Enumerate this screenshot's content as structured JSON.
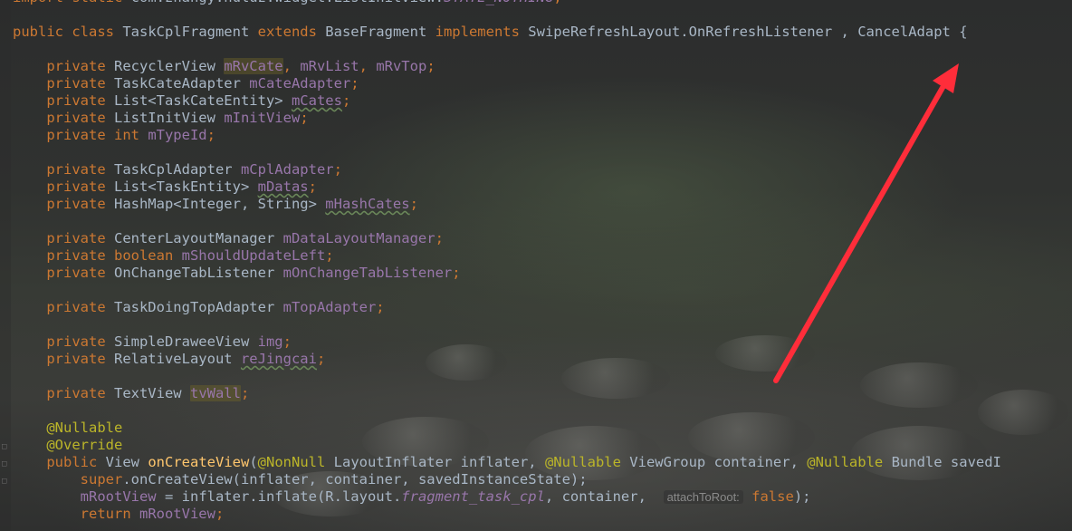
{
  "editor": {
    "lines": [
      [
        [
          "kw",
          "import static "
        ],
        [
          "txt",
          "com.zhangy.huluz.widget.ListInitView."
        ],
        [
          "it",
          "STATE_NOTHING"
        ],
        [
          "kw",
          ";"
        ]
      ],
      [],
      [
        [
          "kw",
          "public class "
        ],
        [
          "txt",
          "TaskCplFragment "
        ],
        [
          "kw",
          "extends "
        ],
        [
          "txt",
          "BaseFragment "
        ],
        [
          "kw",
          "implements "
        ],
        [
          "txt",
          "SwipeRefreshLayout.OnRefreshListener , CancelAdapt {"
        ]
      ],
      [],
      [
        [
          "txt",
          "    "
        ],
        [
          "kw",
          "private "
        ],
        [
          "txt",
          "RecyclerView "
        ],
        [
          "fldhl",
          "mRvCate"
        ],
        [
          "kw",
          ", "
        ],
        [
          "fld",
          "mRvList"
        ],
        [
          "kw",
          ", "
        ],
        [
          "fld",
          "mRvTop"
        ],
        [
          "kw",
          ";"
        ]
      ],
      [
        [
          "txt",
          "    "
        ],
        [
          "kw",
          "private "
        ],
        [
          "txt",
          "TaskCateAdapter "
        ],
        [
          "fld",
          "mCateAdapter"
        ],
        [
          "kw",
          ";"
        ]
      ],
      [
        [
          "txt",
          "    "
        ],
        [
          "kw",
          "private "
        ],
        [
          "txt",
          "List<TaskCateEntity> "
        ],
        [
          "fldsq",
          "mCates"
        ],
        [
          "kw",
          ";"
        ]
      ],
      [
        [
          "txt",
          "    "
        ],
        [
          "kw",
          "private "
        ],
        [
          "txt",
          "ListInitView "
        ],
        [
          "fld",
          "mInitView"
        ],
        [
          "kw",
          ";"
        ]
      ],
      [
        [
          "txt",
          "    "
        ],
        [
          "kw",
          "private int "
        ],
        [
          "fld",
          "mTypeId"
        ],
        [
          "kw",
          ";"
        ]
      ],
      [],
      [
        [
          "txt",
          "    "
        ],
        [
          "kw",
          "private "
        ],
        [
          "txt",
          "TaskCplAdapter "
        ],
        [
          "fld",
          "mCplAdapter"
        ],
        [
          "kw",
          ";"
        ]
      ],
      [
        [
          "txt",
          "    "
        ],
        [
          "kw",
          "private "
        ],
        [
          "txt",
          "List<TaskEntity> "
        ],
        [
          "fldsq",
          "mDatas"
        ],
        [
          "kw",
          ";"
        ]
      ],
      [
        [
          "txt",
          "    "
        ],
        [
          "kw",
          "private "
        ],
        [
          "txt",
          "HashMap<Integer, String> "
        ],
        [
          "fldsq",
          "mHashCates"
        ],
        [
          "kw",
          ";"
        ]
      ],
      [],
      [
        [
          "txt",
          "    "
        ],
        [
          "kw",
          "private "
        ],
        [
          "txt",
          "CenterLayoutManager "
        ],
        [
          "fld",
          "mDataLayoutManager"
        ],
        [
          "kw",
          ";"
        ]
      ],
      [
        [
          "txt",
          "    "
        ],
        [
          "kw",
          "private boolean "
        ],
        [
          "fld",
          "mShouldUpdateLeft"
        ],
        [
          "kw",
          ";"
        ]
      ],
      [
        [
          "txt",
          "    "
        ],
        [
          "kw",
          "private "
        ],
        [
          "txt",
          "OnChangeTabListener "
        ],
        [
          "fld",
          "mOnChangeTabListener"
        ],
        [
          "kw",
          ";"
        ]
      ],
      [],
      [
        [
          "txt",
          "    "
        ],
        [
          "kw",
          "private "
        ],
        [
          "txt",
          "TaskDoingTopAdapter "
        ],
        [
          "fld",
          "mTopAdapter"
        ],
        [
          "kw",
          ";"
        ]
      ],
      [],
      [
        [
          "txt",
          "    "
        ],
        [
          "kw",
          "private "
        ],
        [
          "txt",
          "SimpleDraweeView "
        ],
        [
          "fld",
          "img"
        ],
        [
          "kw",
          ";"
        ]
      ],
      [
        [
          "txt",
          "    "
        ],
        [
          "kw",
          "private "
        ],
        [
          "txt",
          "RelativeLayout "
        ],
        [
          "fldsq",
          "reJingcai"
        ],
        [
          "kw",
          ";"
        ]
      ],
      [],
      [
        [
          "txt",
          "    "
        ],
        [
          "kw",
          "private "
        ],
        [
          "txt",
          "TextView "
        ],
        [
          "fldhl",
          "tvWall"
        ],
        [
          "kw",
          ";"
        ]
      ],
      [],
      [
        [
          "txt",
          "    "
        ],
        [
          "ann",
          "@Nullable"
        ]
      ],
      [
        [
          "txt",
          "    "
        ],
        [
          "ann",
          "@Override"
        ]
      ],
      [
        [
          "txt",
          "    "
        ],
        [
          "kw",
          "public "
        ],
        [
          "txt",
          "View "
        ],
        [
          "fn",
          "onCreateView"
        ],
        [
          "txt",
          "("
        ],
        [
          "ann",
          "@NonNull "
        ],
        [
          "txt",
          "LayoutInflater inflater, "
        ],
        [
          "ann",
          "@Nullable "
        ],
        [
          "txt",
          "ViewGroup container, "
        ],
        [
          "ann",
          "@Nullable "
        ],
        [
          "txt",
          "Bundle savedI"
        ]
      ],
      [
        [
          "txt",
          "        "
        ],
        [
          "kw",
          "super"
        ],
        [
          "txt",
          ".onCreateView(inflater, container, savedInstanceState);"
        ]
      ],
      [
        [
          "txt",
          "        "
        ],
        [
          "fld",
          "mRootView"
        ],
        [
          "txt",
          " = inflater.inflate(R.layout."
        ],
        [
          "it",
          "fragment_task_cpl"
        ],
        [
          "txt",
          ", container,  "
        ],
        [
          "hint",
          "attachToRoot:"
        ],
        [
          "txt",
          " "
        ],
        [
          "kw",
          "false"
        ],
        [
          "txt",
          ");"
        ]
      ],
      [
        [
          "txt",
          "        "
        ],
        [
          "kw",
          "return "
        ],
        [
          "fld",
          "mRootView"
        ],
        [
          "kw",
          ";"
        ]
      ]
    ]
  },
  "colors": {
    "keyword": "#cc7832",
    "field": "#9876aa",
    "annotation": "#bbb529",
    "method": "#ffc66d",
    "text": "#a9b7c6",
    "arrow": "#ff2d3a"
  },
  "annotations": {
    "arrow": "red-arrow-pointing-to-CancelAdapt"
  }
}
